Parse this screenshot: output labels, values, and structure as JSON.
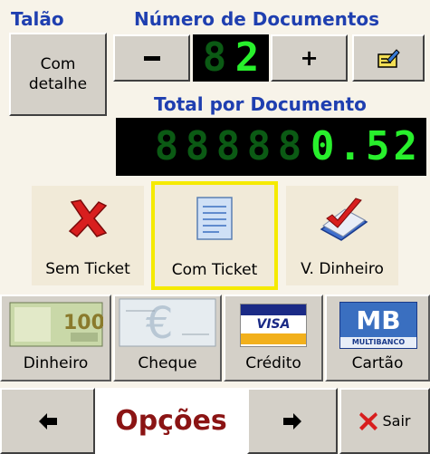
{
  "talao": {
    "header": "Talão",
    "button_line1": "Com",
    "button_line2": "detalhe"
  },
  "documents": {
    "header": "Número de Documentos",
    "minus": "−",
    "count": "2",
    "plus": "+",
    "edit_icon": "edit-pencil-icon"
  },
  "total": {
    "header": "Total por Documento",
    "value": "0.52"
  },
  "ticket_options": [
    {
      "label": "Sem Ticket",
      "icon": "red-x-icon",
      "selected": false
    },
    {
      "label": "Com Ticket",
      "icon": "document-icon",
      "selected": true
    },
    {
      "label": "V. Dinheiro",
      "icon": "checkmark-icon",
      "selected": false
    }
  ],
  "payments": [
    {
      "label": "Dinheiro",
      "icon": "banknote-icon"
    },
    {
      "label": "Cheque",
      "icon": "cheque-icon"
    },
    {
      "label": "Crédito",
      "icon": "visa-card-icon",
      "card_text": "VISA"
    },
    {
      "label": "Cartão",
      "icon": "multibanco-icon",
      "card_text": "MB",
      "card_sub": "MULTIBANCO"
    }
  ],
  "bottom": {
    "title": "Opções",
    "prev_icon": "arrow-left-icon",
    "next_icon": "arrow-right-icon",
    "exit_label": "Sair"
  },
  "colors": {
    "header_blue": "#1f3fb0",
    "lcd_on": "#28f02c",
    "lcd_off": "#0b5a14",
    "selection": "#f5ea00",
    "title_red": "#8b1414"
  }
}
